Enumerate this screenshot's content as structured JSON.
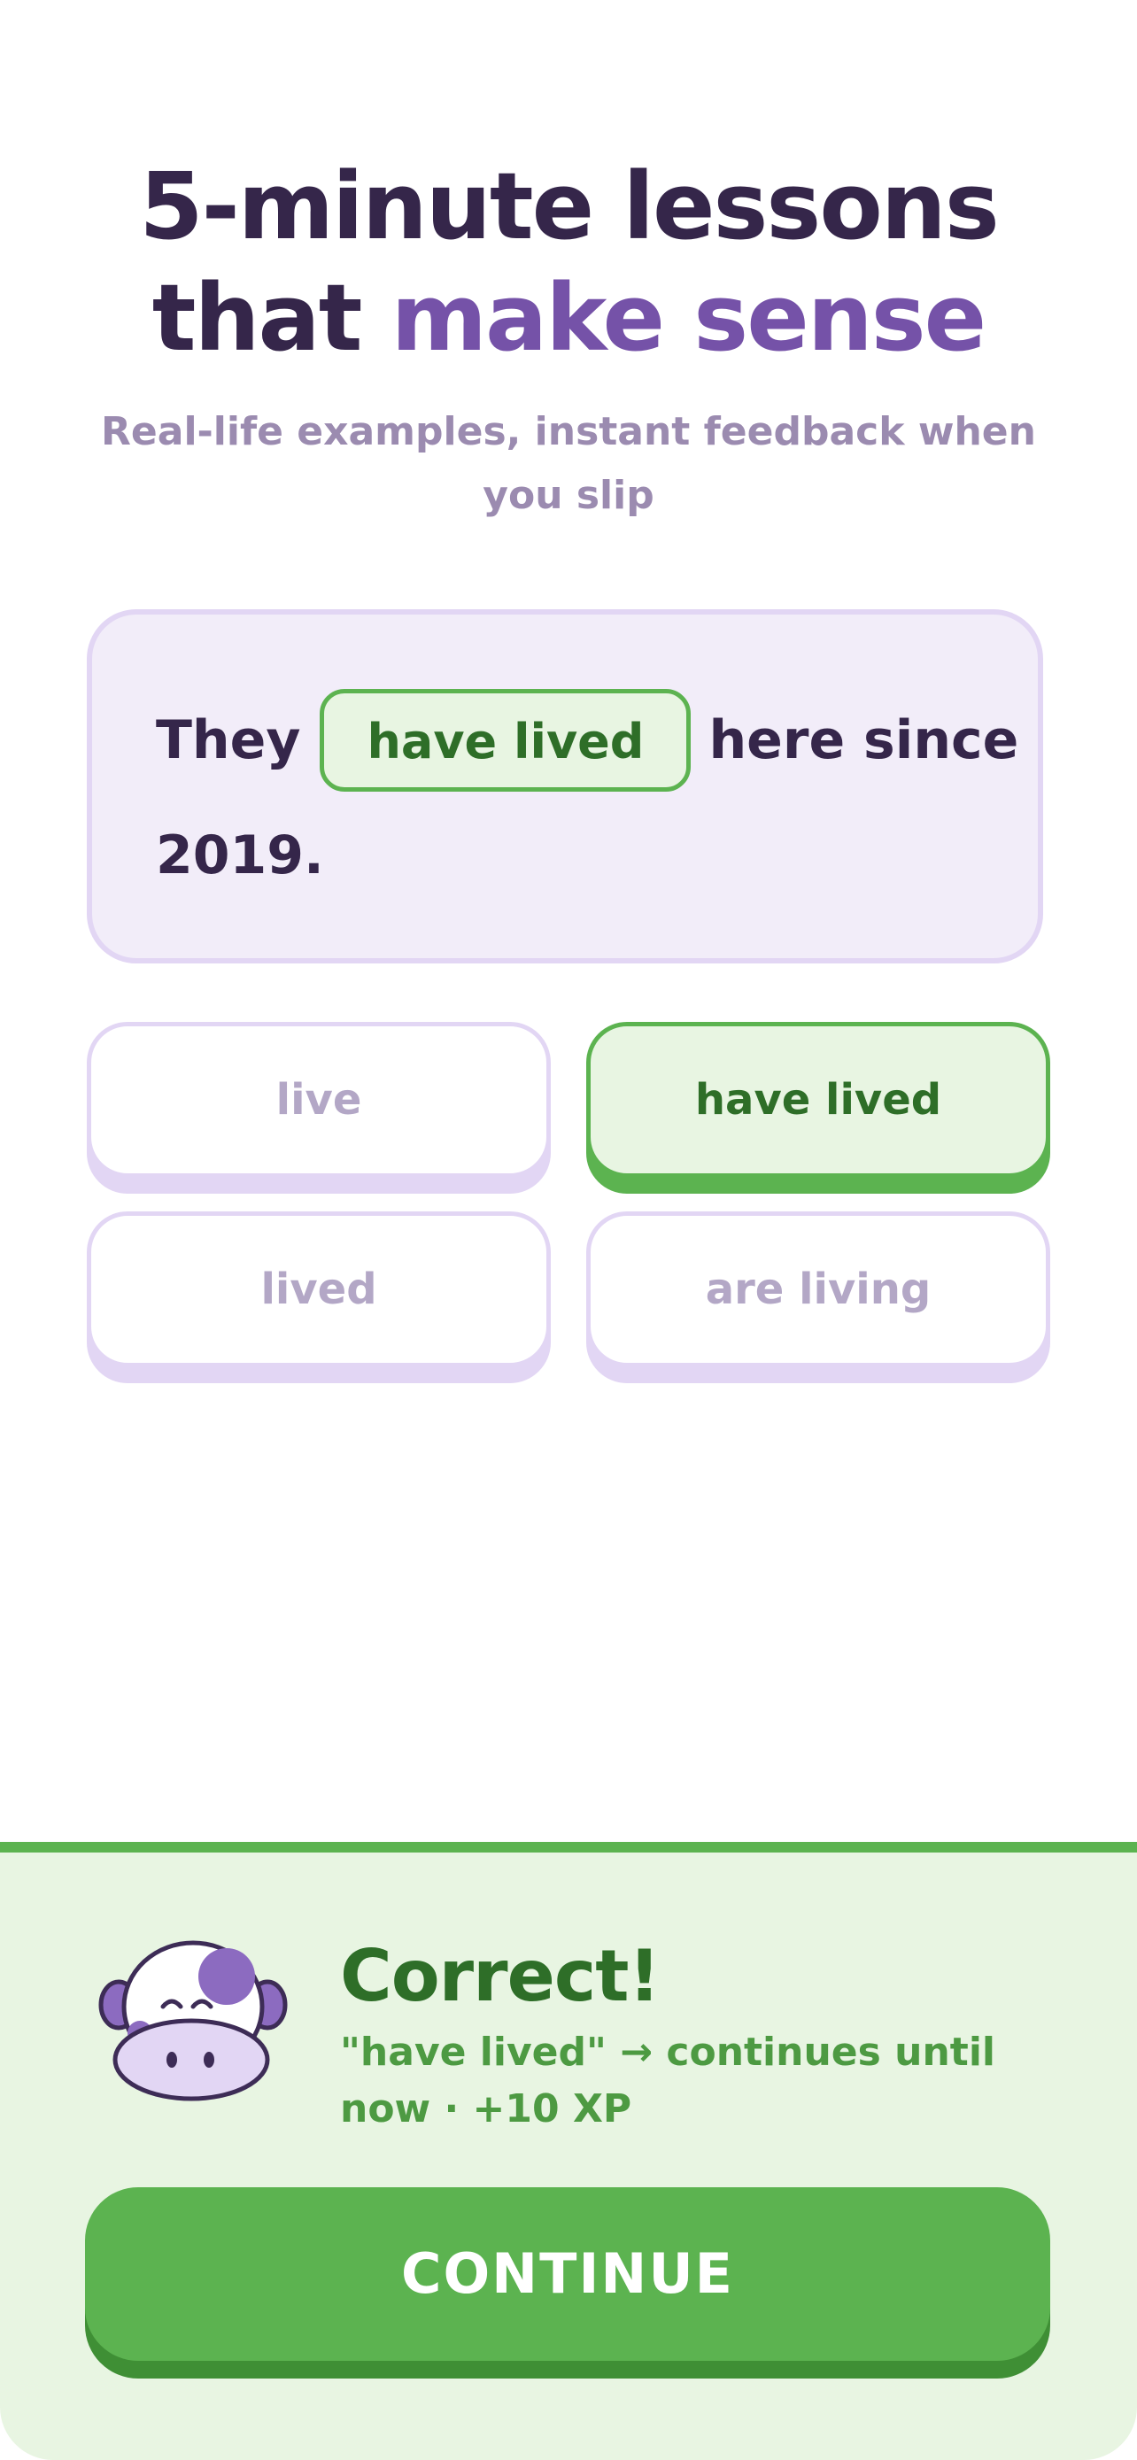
{
  "headline": {
    "line1": "5-minute lessons",
    "line2_prefix": "that ",
    "line2_accent": "make sense"
  },
  "subtitle": "Real-life examples, instant feedback when you slip",
  "exercise": {
    "sentence_before": "They",
    "filled_answer": "have lived",
    "sentence_after": "here since",
    "sentence_end": "2019."
  },
  "options": [
    {
      "label": "live",
      "selected": false
    },
    {
      "label": "have lived",
      "selected": true
    },
    {
      "label": "lived",
      "selected": false
    },
    {
      "label": "are living",
      "selected": false
    }
  ],
  "feedback": {
    "title": "Correct!",
    "detail": "\"have lived\" → continues until now · +10 XP",
    "mascot_icon": "cow-mascot-icon"
  },
  "continue_label": "CONTINUE",
  "colors": {
    "primary_text": "#35264a",
    "accent_purple": "#7552a8",
    "muted_text": "#9b8bb0",
    "card_bg": "#f2edf9",
    "card_border": "#e2d6f4",
    "success_green": "#5cb350",
    "success_dark": "#2e6e28",
    "success_bg": "#e8f5e2"
  }
}
